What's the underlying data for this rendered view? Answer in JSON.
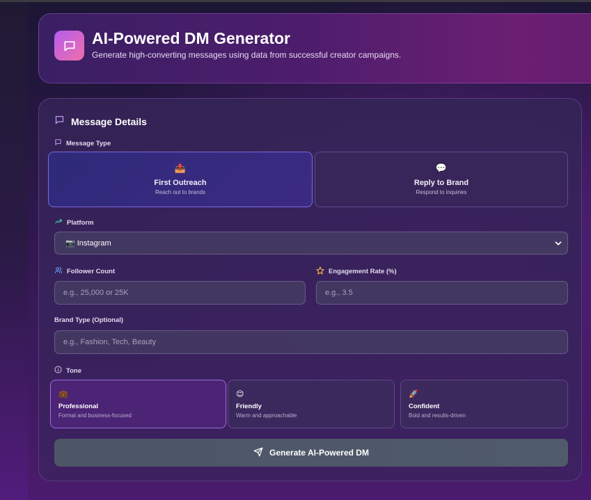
{
  "header": {
    "title": "AI-Powered DM Generator",
    "subtitle": "Generate high-converting messages using data from successful creator campaigns.",
    "icon": "chat-bubble-icon"
  },
  "form": {
    "section_title": "Message Details",
    "message_type": {
      "label": "Message Type",
      "options": [
        {
          "emoji": "📤",
          "title": "First Outreach",
          "subtitle": "Reach out to brands",
          "selected": true
        },
        {
          "emoji": "💬",
          "title": "Reply to Brand",
          "subtitle": "Respond to inquiries",
          "selected": false
        }
      ]
    },
    "platform": {
      "label": "Platform",
      "selected_value": "📷 Instagram"
    },
    "follower_count": {
      "label": "Follower Count",
      "placeholder": "e.g., 25,000 or 25K"
    },
    "engagement_rate": {
      "label": "Engagement Rate (%)",
      "placeholder": "e.g., 3.5"
    },
    "brand_type": {
      "label": "Brand Type (Optional)",
      "placeholder": "e.g., Fashion, Tech, Beauty"
    },
    "tone": {
      "label": "Tone",
      "options": [
        {
          "emoji": "💼",
          "title": "Professional",
          "subtitle": "Formal and business-focused",
          "selected": true
        },
        {
          "emoji": "😊",
          "title": "Friendly",
          "subtitle": "Warm and approachable",
          "selected": false
        },
        {
          "emoji": "🚀",
          "title": "Confident",
          "subtitle": "Bold and results-driven",
          "selected": false
        }
      ]
    },
    "submit_label": "Generate AI-Powered DM"
  },
  "colors": {
    "accent_purple": "#a46be0",
    "logo_gradient_start": "#b45cf0",
    "logo_gradient_end": "#f06fa9",
    "button_bg": "#4d5667"
  }
}
